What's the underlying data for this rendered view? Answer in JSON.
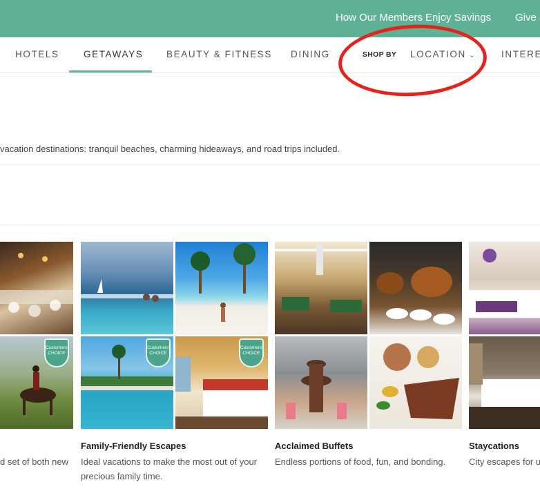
{
  "topbar": {
    "links": [
      "How Our Members Enjoy Savings",
      "Give a"
    ]
  },
  "nav": {
    "tabs": [
      "HOTELS",
      "GETAWAYS",
      "BEAUTY & FITNESS",
      "DINING"
    ],
    "active_tab": "GETAWAYS",
    "shop_by_label": "SHOP BY",
    "location_label": "LOCATION",
    "interests_label": "INTERES"
  },
  "intro": {
    "description": "vacation destinations: tranquil beaches, charming hideaways, and road trips included."
  },
  "cards": [
    {
      "title": "",
      "subtitle": "d set of both new"
    },
    {
      "title": "Family-Friendly Escapes",
      "subtitle": "Ideal vacations to make the most out of your precious family time."
    },
    {
      "title": "Acclaimed Buffets",
      "subtitle": "Endless portions of food, fun, and bonding."
    },
    {
      "title": "Staycations",
      "subtitle": "City escapes for u"
    }
  ],
  "badge_text": "Customers' CHOICE",
  "colors": {
    "brand_green": "#5fb196",
    "annotation_red": "#e4231b"
  }
}
